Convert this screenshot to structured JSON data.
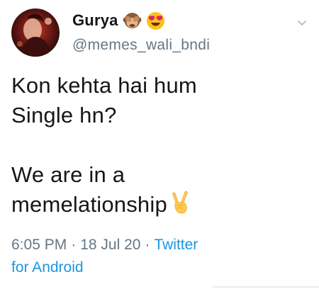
{
  "user": {
    "display_name": "Gurya",
    "name_emojis": [
      "see-no-evil-monkey-emoji",
      "heart-eyes-emoji"
    ],
    "handle": "@memes_wali_bndi"
  },
  "tweet": {
    "lines": [
      "Kon kehta hai hum",
      "Single hn?",
      "",
      "We are in a",
      "memelationship"
    ],
    "trailing_emoji": "victory-hand-emoji"
  },
  "meta": {
    "time": "6:05 PM",
    "separator": "·",
    "date": "18 Jul 20",
    "source_line1": "Twitter",
    "source_line2": "for Android"
  },
  "colors": {
    "text": "#14171a",
    "secondary": "#657786",
    "link": "#1b95e0"
  },
  "icons": {
    "menu": "chevron-down-icon",
    "avatar": "profile-avatar"
  }
}
